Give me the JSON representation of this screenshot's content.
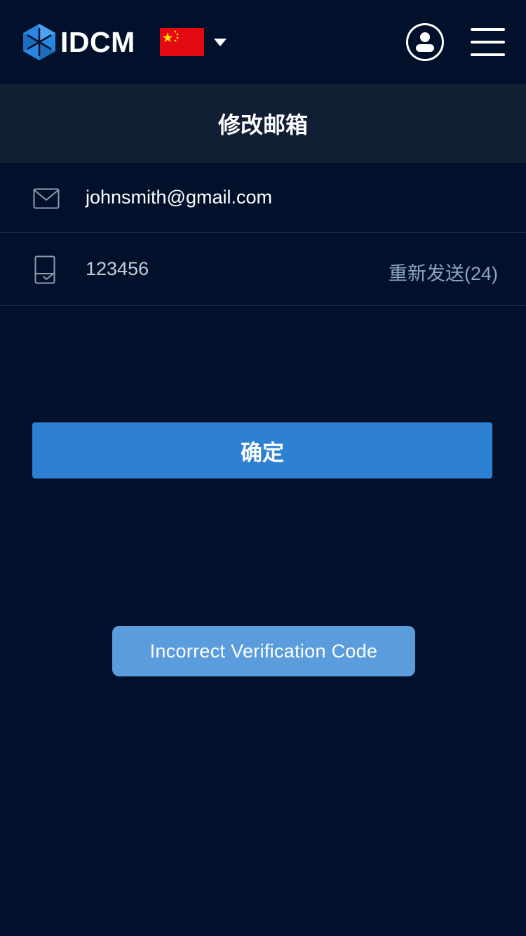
{
  "header": {
    "brand": "IDCM",
    "logo_icon": "idcm-hexagon-logo",
    "flag_icon": "china-flag-icon",
    "dropdown_icon": "caret-down-icon",
    "user_icon": "user-account-icon",
    "menu_icon": "hamburger-menu-icon"
  },
  "page": {
    "title": "修改邮箱"
  },
  "form": {
    "email_icon": "envelope-icon",
    "email_value": "johnsmith@gmail.com",
    "code_icon": "verification-code-icon",
    "code_value": "123456",
    "resend_label": "重新发送(24)"
  },
  "actions": {
    "confirm_label": "确定"
  },
  "toast": {
    "message": "Incorrect Verification Code"
  },
  "colors": {
    "background": "#02112b",
    "title_bar": "#111f35",
    "primary_button": "#2e80d2",
    "toast": "#5b9cdc",
    "resend_text": "#8ea3c2",
    "logo_blue": "#2a86e0"
  }
}
